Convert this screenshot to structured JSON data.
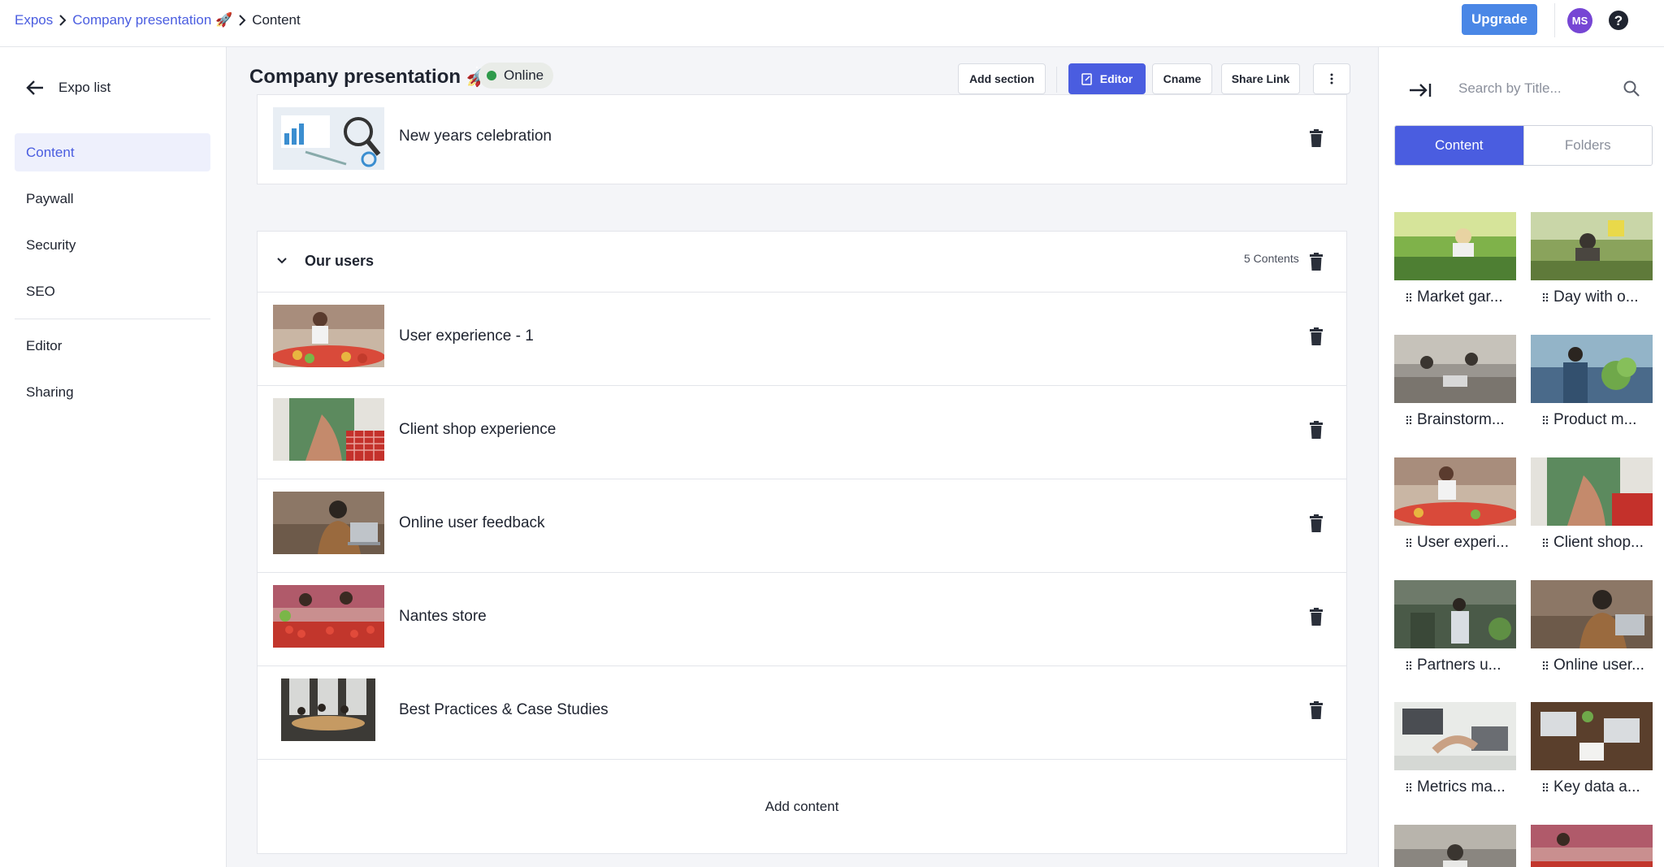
{
  "breadcrumb": {
    "items": [
      "Expos",
      "Company presentation 🚀",
      "Content"
    ]
  },
  "topbar": {
    "upgrade_label": "Upgrade",
    "avatar_initials": "MS",
    "help_icon": "question-circle-icon"
  },
  "sidebar": {
    "back_label": "Expo list",
    "items": [
      {
        "label": "Content",
        "active": true
      },
      {
        "label": "Paywall",
        "active": false
      },
      {
        "label": "Security",
        "active": false
      },
      {
        "label": "SEO",
        "active": false
      },
      {
        "label": "Editor",
        "active": false
      },
      {
        "label": "Sharing",
        "active": false
      }
    ]
  },
  "header": {
    "title": "Company presentation 🚀",
    "status": "Online",
    "buttons": {
      "add_section": "Add section",
      "editor": "Editor",
      "cname": "Cname",
      "share_link": "Share Link"
    }
  },
  "content": {
    "top_row": {
      "title": "New years celebration"
    },
    "section": {
      "title": "Our users",
      "count": "5 Contents",
      "rows": [
        {
          "title": "User experience - 1"
        },
        {
          "title": "Client shop experience"
        },
        {
          "title": "Online user feedback"
        },
        {
          "title": "Nantes store"
        },
        {
          "title": "Best Practices & Case Studies"
        }
      ],
      "add_content_label": "Add content"
    }
  },
  "right_panel": {
    "search_placeholder": "Search by Title...",
    "tabs": {
      "content": "Content",
      "folders": "Folders"
    },
    "tiles": [
      "Market gar...",
      "Day with o...",
      "Brainstorm...",
      "Product m...",
      "User experi...",
      "Client shop...",
      "Partners u...",
      "Online user...",
      "Metrics ma...",
      "Key data a..."
    ]
  },
  "colors": {
    "accent": "#4a5de0",
    "upgrade": "#4a87e6",
    "avatar": "#7646d4",
    "online": "#2e9a4a"
  }
}
